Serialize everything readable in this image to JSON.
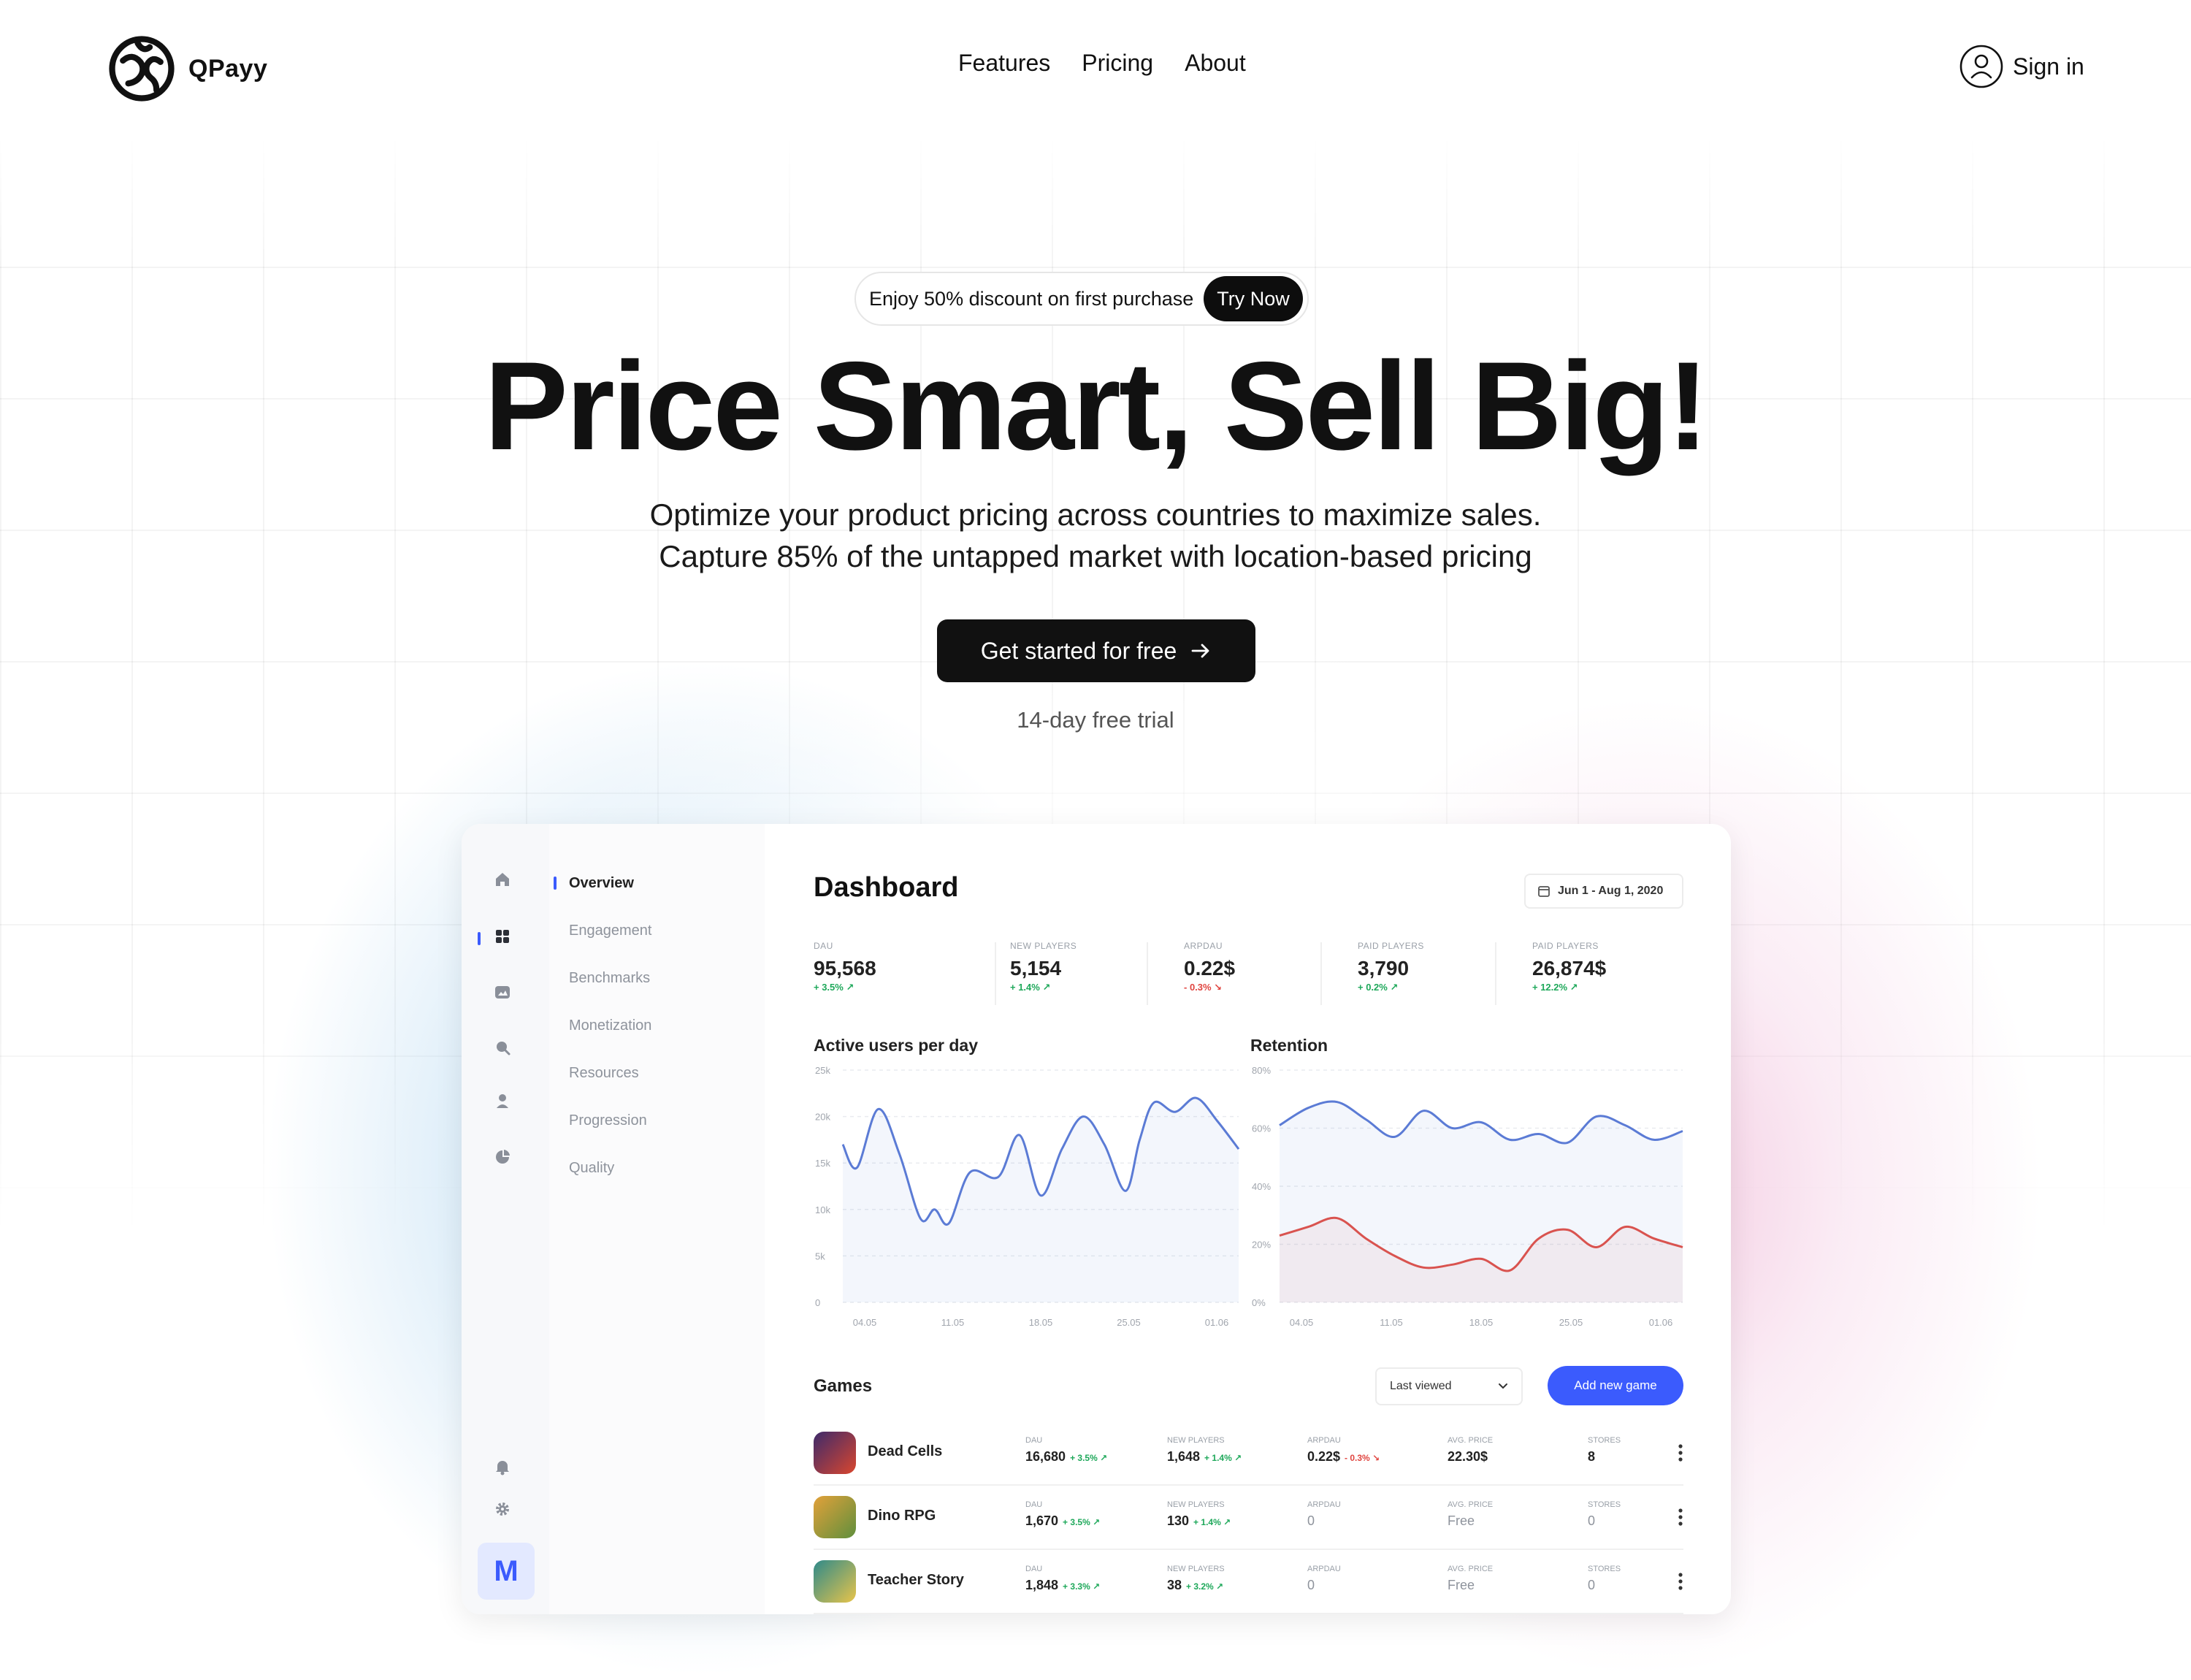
{
  "brand": {
    "name": "QPayy",
    "logo": "qpayy-logo"
  },
  "nav": {
    "links": [
      {
        "label": "Features"
      },
      {
        "label": "Pricing"
      },
      {
        "label": "About"
      }
    ],
    "signin": {
      "label": "Sign in",
      "icon": "user-circle-icon"
    }
  },
  "hero": {
    "promo_text": "Enjoy 50% discount on first purchase",
    "promo_button": "Try Now",
    "headline": "Price Smart, Sell Big!",
    "subline_1": "Optimize your product pricing across countries to maximize sales.",
    "subline_2": "Capture 85% of the untapped market with location-based pricing",
    "cta": "Get started for free",
    "trial": "14-day free trial"
  },
  "dashboard": {
    "rail_icons": [
      "home-icon",
      "grid-icon",
      "image-icon",
      "search-icon",
      "user-icon",
      "pie-chart-icon",
      "bell-icon",
      "gear-icon"
    ],
    "avatar_letter": "M",
    "subnav": [
      "Overview",
      "Engagement",
      "Benchmarks",
      "Monetization",
      "Resources",
      "Progression",
      "Quality"
    ],
    "title": "Dashboard",
    "date_range": "Jun 1 - Aug 1, 2020",
    "stats": [
      {
        "label": "DAU",
        "value": "95,568",
        "change": "+ 3.5% ↗",
        "dir": "up"
      },
      {
        "label": "New players",
        "value": "5,154",
        "change": "+ 1.4% ↗",
        "dir": "up"
      },
      {
        "label": "ARPDAU",
        "value": "0.22$",
        "change": "- 0.3% ↘",
        "dir": "down"
      },
      {
        "label": "Paid players",
        "value": "3,790",
        "change": "+ 0.2% ↗",
        "dir": "up"
      },
      {
        "label": "Paid players",
        "value": "26,874$",
        "change": "+ 12.2% ↗",
        "dir": "up"
      }
    ],
    "games": {
      "title": "Games",
      "sort": "Last viewed",
      "add_button": "Add new game",
      "columns": [
        "DAU",
        "New players",
        "ARPDAU",
        "Avg. price",
        "Stores"
      ],
      "rows": [
        {
          "name": "Dead Cells",
          "thumb_colors": [
            "#3d2a6b",
            "#d9462e"
          ],
          "dau": "16,680",
          "dau_chg": "+ 3.5% ↗",
          "new": "1,648",
          "new_chg": "+ 1.4% ↗",
          "arpdau": "0.22$",
          "arpdau_chg": "- 0.3% ↘",
          "price": "22.30$",
          "stores": "8"
        },
        {
          "name": "Dino RPG",
          "thumb_colors": [
            "#e2a13a",
            "#5f8f3c"
          ],
          "dau": "1,670",
          "dau_chg": "+ 3.5% ↗",
          "new": "130",
          "new_chg": "+ 1.4% ↗",
          "arpdau": "0",
          "arpdau_chg": "",
          "price": "Free",
          "stores": "0"
        },
        {
          "name": "Teacher Story",
          "thumb_colors": [
            "#2f8a8a",
            "#e8c44a"
          ],
          "dau": "1,848",
          "dau_chg": "+ 3.3% ↗",
          "new": "38",
          "new_chg": "+ 3.2% ↗",
          "arpdau": "0",
          "arpdau_chg": "",
          "price": "Free",
          "stores": "0"
        }
      ]
    }
  },
  "chart_data": [
    {
      "type": "line",
      "title": "Active users per day",
      "x_ticks": [
        "04.05",
        "11.05",
        "18.05",
        "25.05",
        "01.06"
      ],
      "y_ticks": [
        "0",
        "5k",
        "10k",
        "15k",
        "20k",
        "25k"
      ],
      "ylim": [
        0,
        25000
      ],
      "xlim": [
        0,
        28
      ],
      "grid": true,
      "color": "#5b7bd5",
      "series": [
        {
          "x": [
            0,
            1,
            2.5,
            4,
            5.5,
            6.5,
            7.5,
            9,
            11,
            12.5,
            14,
            15.5,
            17,
            18.5,
            20,
            21,
            22,
            23.5,
            25,
            26.5,
            28
          ],
          "values": [
            17000,
            14500,
            20800,
            16000,
            9000,
            10000,
            8500,
            14000,
            13500,
            18000,
            11500,
            16500,
            20000,
            17000,
            12000,
            17500,
            21500,
            20500,
            22000,
            19500,
            16500
          ]
        }
      ]
    },
    {
      "type": "line",
      "title": "Retention",
      "x_ticks": [
        "04.05",
        "11.05",
        "18.05",
        "25.05",
        "01.06"
      ],
      "y_ticks": [
        "0%",
        "20%",
        "40%",
        "60%",
        "80%"
      ],
      "ylim": [
        0,
        80
      ],
      "xlim": [
        0,
        28
      ],
      "grid": true,
      "series": [
        {
          "color": "#5b7bd5",
          "x": [
            0,
            2,
            4,
            6,
            8,
            10,
            12,
            14,
            16,
            18,
            20,
            22,
            24,
            26,
            28
          ],
          "values": [
            61,
            67,
            69,
            63,
            57,
            66,
            60,
            62,
            56,
            58,
            55,
            64,
            61,
            56,
            59
          ]
        },
        {
          "color": "#d9534f",
          "x": [
            0,
            2,
            4,
            6,
            8,
            10,
            12,
            14,
            16,
            18,
            20,
            22,
            24,
            26,
            28
          ],
          "values": [
            23,
            26,
            29,
            22,
            16,
            12,
            13,
            15,
            11,
            22,
            25,
            19,
            26,
            22,
            19
          ]
        }
      ]
    }
  ]
}
